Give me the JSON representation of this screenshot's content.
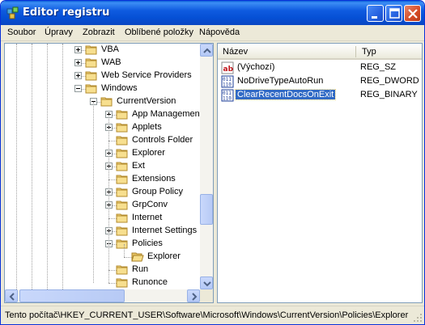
{
  "window": {
    "title": "Editor registru"
  },
  "menu": {
    "items": [
      "Soubor",
      "Úpravy",
      "Zobrazit",
      "Oblíbené položky",
      "Nápověda"
    ]
  },
  "tree": {
    "items": [
      {
        "label": "VBA",
        "expander": "plus",
        "level": 0
      },
      {
        "label": "WAB",
        "expander": "plus",
        "level": 0
      },
      {
        "label": "Web Service Providers",
        "expander": "plus",
        "level": 0
      },
      {
        "label": "Windows",
        "expander": "minus",
        "level": 0
      },
      {
        "label": "CurrentVersion",
        "expander": "minus",
        "level": 1
      },
      {
        "label": "App Management",
        "expander": "plus",
        "level": 2
      },
      {
        "label": "Applets",
        "expander": "plus",
        "level": 2
      },
      {
        "label": "Controls Folder",
        "expander": "none",
        "level": 2
      },
      {
        "label": "Explorer",
        "expander": "plus",
        "level": 2
      },
      {
        "label": "Ext",
        "expander": "plus",
        "level": 2
      },
      {
        "label": "Extensions",
        "expander": "none",
        "level": 2
      },
      {
        "label": "Group Policy",
        "expander": "plus",
        "level": 2
      },
      {
        "label": "GrpConv",
        "expander": "plus",
        "level": 2
      },
      {
        "label": "Internet",
        "expander": "none",
        "level": 2
      },
      {
        "label": "Internet Settings",
        "expander": "plus",
        "level": 2
      },
      {
        "label": "Policies",
        "expander": "minus",
        "level": 2
      },
      {
        "label": "Explorer",
        "expander": "none",
        "level": 3,
        "open": true
      },
      {
        "label": "Run",
        "expander": "none",
        "level": 2
      },
      {
        "label": "Runonce",
        "expander": "none",
        "level": 2
      }
    ]
  },
  "list": {
    "columns": {
      "name": "Název",
      "type": "Typ"
    },
    "rows": [
      {
        "name": "(Výchozí)",
        "type": "REG_SZ",
        "icon": "string-value-icon",
        "selected": false
      },
      {
        "name": "NoDriveTypeAutoRun",
        "type": "REG_DWORD",
        "icon": "binary-value-icon",
        "selected": false
      },
      {
        "name": "ClearRecentDocsOnExit",
        "type": "REG_BINARY",
        "icon": "binary-value-icon",
        "selected": true
      }
    ]
  },
  "status": {
    "path": "Tento počítač\\HKEY_CURRENT_USER\\Software\\Microsoft\\Windows\\CurrentVersion\\Policies\\Explorer"
  },
  "colors": {
    "titlebar": "#0550d5",
    "selection": "#316ac5",
    "close_button": "#d54a25"
  }
}
